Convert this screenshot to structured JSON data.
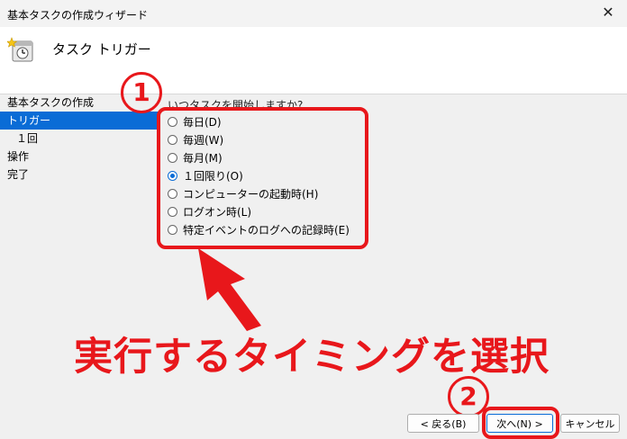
{
  "window": {
    "title": "基本タスクの作成ウィザード",
    "close_icon": "close-icon"
  },
  "header": {
    "title": "タスク トリガー",
    "icon": "task-clock-icon"
  },
  "steps": [
    {
      "label": "基本タスクの作成",
      "active": false,
      "sub": false
    },
    {
      "label": "トリガー",
      "active": true,
      "sub": false
    },
    {
      "label": "１回",
      "active": false,
      "sub": true
    },
    {
      "label": "操作",
      "active": false,
      "sub": false
    },
    {
      "label": "完了",
      "active": false,
      "sub": false
    }
  ],
  "question": "いつタスクを開始しますか?",
  "options": [
    {
      "label": "毎日(D)",
      "selected": false
    },
    {
      "label": "毎週(W)",
      "selected": false
    },
    {
      "label": "毎月(M)",
      "selected": false
    },
    {
      "label": "１回限り(O)",
      "selected": true
    },
    {
      "label": "コンピューターの起動時(H)",
      "selected": false
    },
    {
      "label": "ログオン時(L)",
      "selected": false
    },
    {
      "label": "特定イベントのログへの記録時(E)",
      "selected": false
    }
  ],
  "annotations": {
    "step1": "1",
    "step2": "2",
    "caption": "実行するタイミングを選択",
    "color": "#e8171b"
  },
  "buttons": {
    "back": "< 戻る(B)",
    "next": "次へ(N) >",
    "cancel": "キャンセル"
  }
}
